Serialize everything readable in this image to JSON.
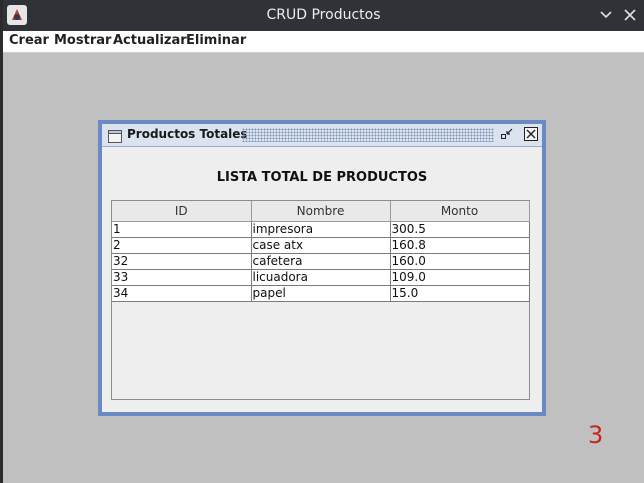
{
  "window": {
    "title": "CRUD Productos"
  },
  "menubar": {
    "items": [
      {
        "label": "Crear"
      },
      {
        "label": "Mostrar"
      },
      {
        "label": "Actualizar"
      },
      {
        "label": "Eliminar"
      }
    ]
  },
  "internal_frame": {
    "title": "Productos Totales",
    "heading": "LISTA TOTAL DE PRODUCTOS",
    "table": {
      "columns": [
        "ID",
        "Nombre",
        "Monto"
      ],
      "rows": [
        [
          "1",
          "impresora",
          "300.5"
        ],
        [
          "2",
          "case atx",
          "160.8"
        ],
        [
          "32",
          "cafetera",
          "160.0"
        ],
        [
          "33",
          "licuadora",
          "109.0"
        ],
        [
          "34",
          "papel",
          "15.0"
        ]
      ]
    }
  },
  "annotation": {
    "number": "3",
    "color": "#c8241b"
  },
  "colors": {
    "titlebar": "#2f3236",
    "desktop": "#c0c0c0",
    "frame_border": "#6a8ac4"
  }
}
